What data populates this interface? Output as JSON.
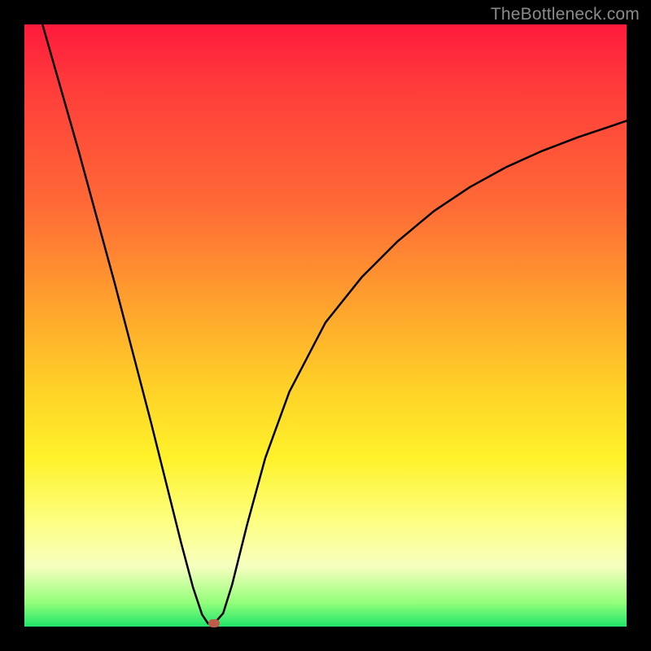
{
  "watermark": "TheBottleneck.com",
  "chart_data": {
    "type": "line",
    "title": "",
    "xlabel": "",
    "ylabel": "",
    "xlim": [
      0,
      1
    ],
    "ylim": [
      0,
      1
    ],
    "gradient_stops": [
      {
        "pos": 0.0,
        "color": "#ff1a3c"
      },
      {
        "pos": 0.3,
        "color": "#ff6a36"
      },
      {
        "pos": 0.6,
        "color": "#ffd027"
      },
      {
        "pos": 0.82,
        "color": "#fdff7d"
      },
      {
        "pos": 0.96,
        "color": "#94ff7a"
      },
      {
        "pos": 1.0,
        "color": "#20e56a"
      }
    ],
    "series": [
      {
        "name": "bottleneck-curve",
        "x": [
          0.03,
          0.06,
          0.09,
          0.12,
          0.15,
          0.18,
          0.21,
          0.24,
          0.26,
          0.28,
          0.295,
          0.305,
          0.315,
          0.33,
          0.345,
          0.37,
          0.4,
          0.44,
          0.5,
          0.56,
          0.62,
          0.68,
          0.74,
          0.8,
          0.86,
          0.92,
          0.98,
          1.0
        ],
        "y": [
          1.0,
          0.895,
          0.79,
          0.68,
          0.57,
          0.455,
          0.34,
          0.22,
          0.14,
          0.065,
          0.02,
          0.005,
          0.005,
          0.022,
          0.07,
          0.17,
          0.28,
          0.39,
          0.505,
          0.58,
          0.64,
          0.69,
          0.73,
          0.763,
          0.79,
          0.813,
          0.833,
          0.84
        ]
      }
    ],
    "marker": {
      "x": 0.315,
      "y": 0.006,
      "color": "#c05a4a"
    },
    "notch_region": {
      "x_start": 0.295,
      "x_end": 0.33,
      "y": 0.0
    }
  }
}
